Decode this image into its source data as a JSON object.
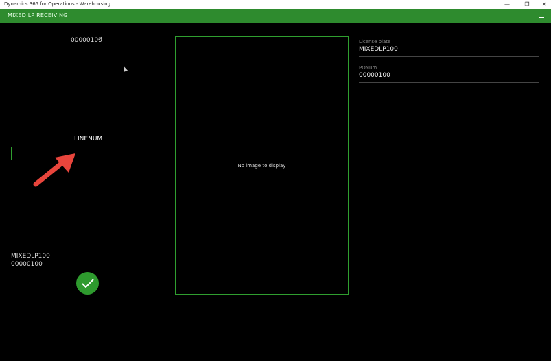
{
  "window": {
    "title": "Dynamics 365 for Operations - Warehousing",
    "minimize_glyph": "—",
    "maximize_glyph": "❐",
    "close_glyph": "✕"
  },
  "appbar": {
    "title": "MIXED LP RECEIVING",
    "menu_icon": "hamburger-menu-icon"
  },
  "left": {
    "top_value": "00000100",
    "top_check": "✓",
    "field_label": "LINENUM",
    "input_value": "",
    "summary": [
      "MIXEDLP100",
      "00000100"
    ],
    "ok_icon": "checkmark-icon"
  },
  "image_panel": {
    "message": "No image to display"
  },
  "details": [
    {
      "label": "License plate",
      "value": "MIXEDLP100"
    },
    {
      "label": "PONum",
      "value": "00000100"
    }
  ],
  "colors": {
    "accent": "#2e8b2e",
    "border": "#2f9e2f",
    "annotation_arrow": "#e8453c"
  }
}
